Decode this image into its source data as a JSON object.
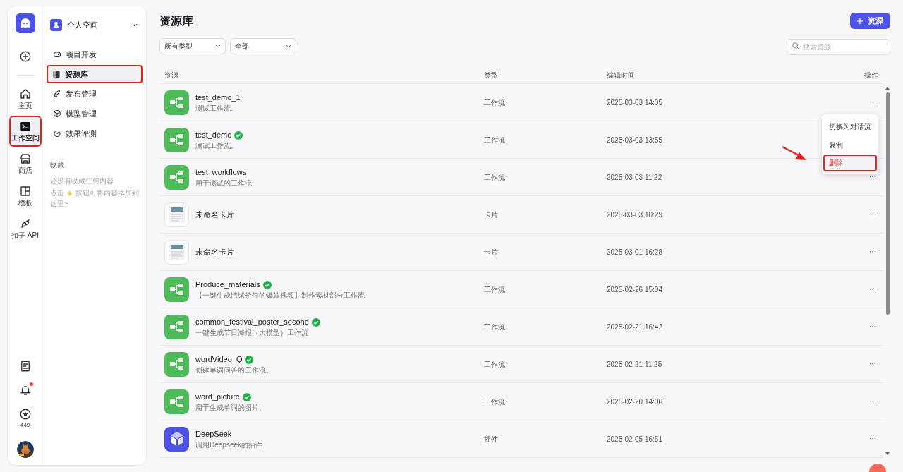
{
  "rail": {
    "top": [
      {
        "kind": "add",
        "selected": false,
        "annotated": false
      },
      {
        "kind": "home",
        "label": "主页",
        "selected": false,
        "annotated": false
      },
      {
        "kind": "workspace",
        "label": "工作空间",
        "selected": true,
        "annotated": true
      },
      {
        "kind": "store",
        "label": "商店",
        "selected": false,
        "annotated": false
      },
      {
        "kind": "template",
        "label": "模板",
        "selected": false,
        "annotated": false
      },
      {
        "kind": "api",
        "label": "扣子 API",
        "selected": false,
        "annotated": false
      }
    ],
    "bottom": [
      {
        "kind": "doc"
      },
      {
        "kind": "bell",
        "unread": true
      },
      {
        "kind": "credits",
        "label": "449"
      }
    ]
  },
  "space": {
    "name": "个人空间"
  },
  "nav": [
    {
      "kind": "project",
      "label": "项目开发",
      "selected": false,
      "annotated": false
    },
    {
      "kind": "library",
      "label": "资源库",
      "selected": true,
      "annotated": true
    },
    {
      "kind": "publish",
      "label": "发布管理",
      "selected": false,
      "annotated": false
    },
    {
      "kind": "model",
      "label": "模型管理",
      "selected": false,
      "annotated": false
    },
    {
      "kind": "eval",
      "label": "效果评测",
      "selected": false,
      "annotated": false
    }
  ],
  "favorites": {
    "title": "收藏",
    "empty": "还没有收藏任何内容",
    "hint_before": "点击",
    "hint_after": "按钮可将内容添加到",
    "hint_end": "这里~"
  },
  "page": {
    "title": "资源库",
    "add_button": "资源",
    "filters": [
      "所有类型",
      "全部"
    ],
    "search": {
      "placeholder": "搜索资源"
    }
  },
  "table": {
    "columns": [
      "资源",
      "类型",
      "编辑时间",
      "操作"
    ],
    "rows": [
      {
        "kind": "workflow",
        "name": "test_demo_1",
        "verified": false,
        "description": "测试工作流。",
        "type": "工作流",
        "time": "2025-03-03 14:05",
        "action": "···"
      },
      {
        "kind": "workflow",
        "name": "test_demo",
        "verified": true,
        "description": "测试工作流。",
        "type": "工作流",
        "time": "2025-03-03 13:55"
      },
      {
        "kind": "workflow",
        "name": "test_workflows",
        "verified": false,
        "description": "用于测试的工作流",
        "type": "工作流",
        "time": "2025-03-03 11:22",
        "action": "···"
      },
      {
        "kind": "card",
        "name": "未命名卡片",
        "verified": false,
        "type": "卡片",
        "time": "2025-03-03 10:29",
        "action": "···"
      },
      {
        "kind": "card",
        "name": "未命名卡片",
        "verified": false,
        "type": "卡片",
        "time": "2025-03-01 16:28",
        "action": "···"
      },
      {
        "kind": "workflow",
        "name": "Produce_materials",
        "verified": true,
        "description": "【一键生成情绪价值的爆款视频】制作素材部分工作流",
        "type": "工作流",
        "time": "2025-02-26 15:04",
        "action": "···"
      },
      {
        "kind": "workflow",
        "name": "common_festival_poster_second",
        "verified": true,
        "description": "一键生成节日海报（大模型）工作流",
        "type": "工作流",
        "time": "2025-02-21 16:42",
        "action": "···"
      },
      {
        "kind": "workflow",
        "name": "wordVideo_Q",
        "verified": true,
        "description": "创建单词问答的工作流。",
        "type": "工作流",
        "time": "2025-02-21 11:25",
        "action": "···"
      },
      {
        "kind": "workflow",
        "name": "word_picture",
        "verified": true,
        "description": "用于生成单词的图片。",
        "type": "工作流",
        "time": "2025-02-20 14:06",
        "action": "···"
      },
      {
        "kind": "plugin",
        "name": "DeepSeek",
        "verified": false,
        "description": "调用Deepseek的插件",
        "type": "插件",
        "time": "2025-02-05 16:51",
        "action": "···"
      }
    ]
  },
  "context_menu": {
    "items": [
      {
        "label": "切换为对话流",
        "kind": "normal",
        "hovered": false,
        "annotated": false
      },
      {
        "label": "复制",
        "kind": "normal",
        "hovered": false,
        "annotated": false
      },
      {
        "label": "删除",
        "kind": "danger",
        "hovered": true,
        "annotated": true
      }
    ]
  }
}
